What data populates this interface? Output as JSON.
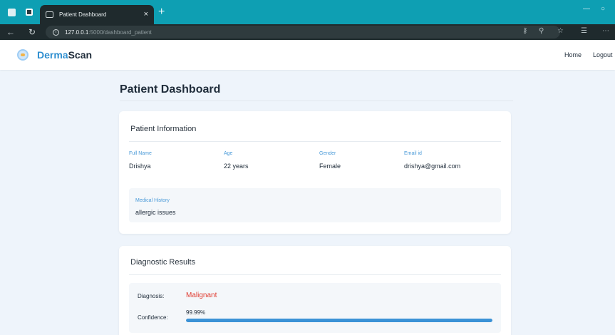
{
  "browser": {
    "tab_title": "Patient Dashboard",
    "tab_close": "×",
    "new_tab": "+",
    "url_host": "127.0.0.1",
    "url_path": ":5000/dashboard_patient",
    "info_icon": "i"
  },
  "header": {
    "brand_part1": "Derma",
    "brand_part2": "Scan",
    "nav": [
      "Home",
      "Logout"
    ]
  },
  "page": {
    "title": "Patient Dashboard"
  },
  "patient_info": {
    "section_title": "Patient Information",
    "fields": [
      {
        "label": "Full Name",
        "value": "Drishya"
      },
      {
        "label": "Age",
        "value": "22 years"
      },
      {
        "label": "Gender",
        "value": "Female"
      },
      {
        "label": "Email id",
        "value": "drishya@gmail.com"
      }
    ],
    "medical_history_label": "Medical History",
    "medical_history_value": "allergic issues"
  },
  "diagnostic": {
    "section_title": "Diagnostic Results",
    "diagnosis_label": "Diagnosis:",
    "diagnosis_value": "Malignant",
    "confidence_label": "Confidence:",
    "confidence_value": "99.99%",
    "confidence_fraction": 0.9999
  },
  "colors": {
    "chrome_accent": "#0e9fb3",
    "brand_accent": "#2f8fd0",
    "label_blue": "#4a9ad8",
    "diagnosis_red": "#e03c31",
    "progress_fill": "#3b92d6"
  }
}
